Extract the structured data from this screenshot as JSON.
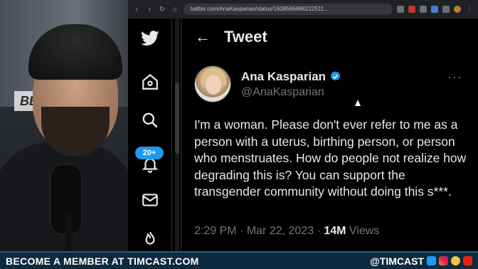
{
  "browser": {
    "url": "twitter.com/AnaKasparian/status/1638586688222511..."
  },
  "twitter_sidebar": {
    "notifications_badge": "20+"
  },
  "header": {
    "title": "Tweet"
  },
  "tweet": {
    "author_name": "Ana Kasparian",
    "author_handle": "@AnaKasparian",
    "text": "I'm a woman. Please don't ever refer to me as a person with a uterus, birthing person, or person who menstruates. How do people not realize how degrading this is? You can support the transgender community without doing this s***.",
    "time": "2:29 PM",
    "date": "Mar 22, 2023",
    "views_count": "14M",
    "views_label": "Views",
    "separator": "·"
  },
  "webcam": {
    "sign_text": "BE"
  },
  "ticker": {
    "left_text": "BECOME A MEMBER AT TIMCAST.COM",
    "right_text": "@TIMCAST"
  },
  "colors": {
    "accent": "#1d9bf0",
    "ticker_bg": "#0e2a3f"
  }
}
